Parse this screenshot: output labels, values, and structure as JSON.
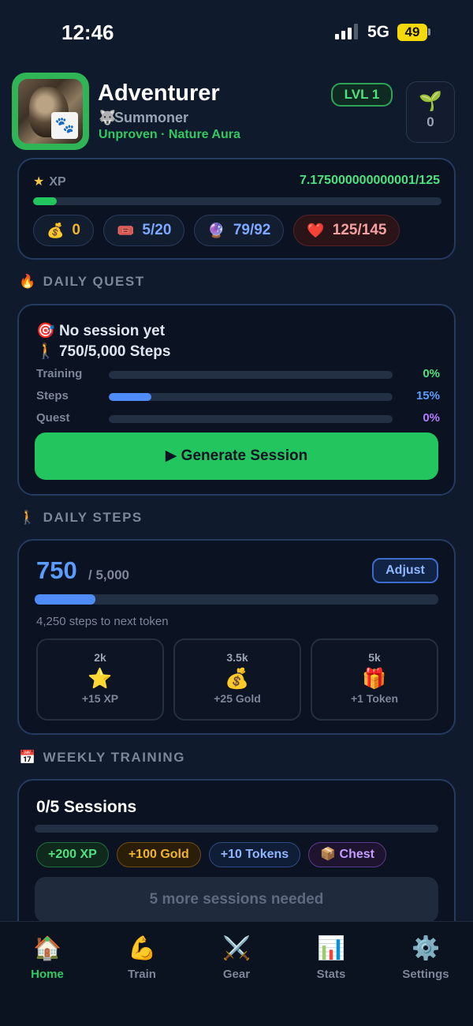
{
  "status_bar": {
    "time": "12:46",
    "network": "5G",
    "battery": "49"
  },
  "profile": {
    "name": "Adventurer",
    "class": "Summoner",
    "aura": "Unproven · Nature Aura",
    "level": "LVL 1",
    "seeds": "0"
  },
  "xp": {
    "label": "XP",
    "value": "7.175000000000001/125",
    "progress": 0.057
  },
  "currencies": {
    "gold": "0",
    "tickets": "5/20",
    "mana": "79/92",
    "health": "125/145"
  },
  "daily_quest": {
    "title": "DAILY QUEST",
    "session": "No session yet",
    "steps": "750/5,000 Steps",
    "rows": [
      {
        "label": "Training",
        "pct": "0%",
        "progress": 0.0,
        "color": "#22c55e"
      },
      {
        "label": "Steps",
        "pct": "15%",
        "progress": 0.15,
        "color": "#4f8cf7"
      },
      {
        "label": "Quest",
        "pct": "0%",
        "progress": 0.0,
        "color": "#a855f7"
      }
    ],
    "button": "▶ Generate Session"
  },
  "daily_steps": {
    "title": "DAILY STEPS",
    "count": "750",
    "goal": "/ 5,000",
    "adjust": "Adjust",
    "progress": 0.15,
    "next": "4,250 steps to next token",
    "milestones": [
      {
        "target": "2k",
        "icon": "star-icon",
        "reward": "+15 XP"
      },
      {
        "target": "3.5k",
        "icon": "money-bag-icon",
        "reward": "+25 Gold"
      },
      {
        "target": "5k",
        "icon": "gift-icon",
        "reward": "+1 Token"
      }
    ]
  },
  "weekly_training": {
    "title": "WEEKLY TRAINING",
    "sessions": "0/5 Sessions",
    "progress": 0.0,
    "rewards": [
      "+200 XP",
      "+100 Gold",
      "+10 Tokens",
      "📦 Chest"
    ],
    "button": "5 more sessions needed"
  },
  "tabs": [
    {
      "label": "Home",
      "icon": "house-icon",
      "active": true
    },
    {
      "label": "Train",
      "icon": "flexed-bicep-icon",
      "active": false
    },
    {
      "label": "Gear",
      "icon": "crossed-swords-icon",
      "active": false
    },
    {
      "label": "Stats",
      "icon": "bar-chart-icon",
      "active": false
    },
    {
      "label": "Settings",
      "icon": "gear-icon",
      "active": false
    }
  ],
  "colors": {
    "background": "#0f1a2c",
    "accent_green": "#22c55e",
    "accent_blue": "#4f8cf7",
    "accent_purple": "#a855f7"
  }
}
